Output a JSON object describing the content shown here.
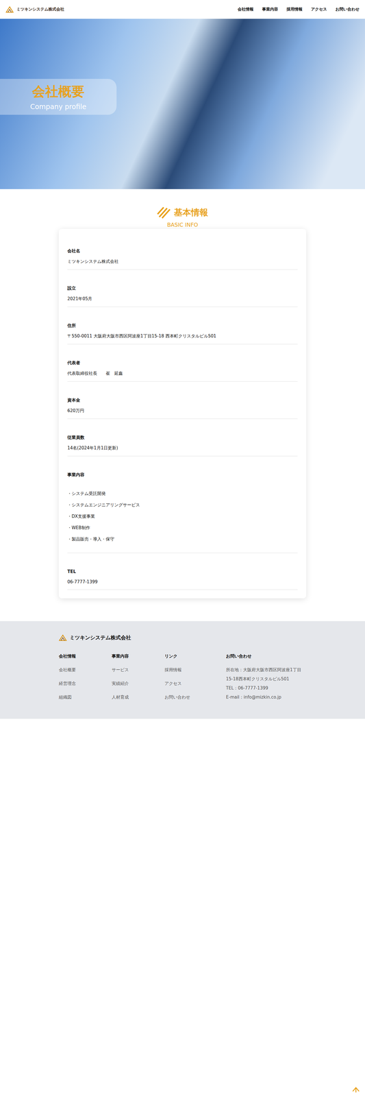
{
  "header": {
    "company": "ミツキンシステム株式会社",
    "nav": [
      "会社情報",
      "事業内容",
      "採用情報",
      "アクセス",
      "お問い合わせ"
    ]
  },
  "hero": {
    "title": "会社概要",
    "subtitle": "Company profile"
  },
  "section": {
    "title": "基本情報",
    "subtitle": "BASIC INFO"
  },
  "info": [
    {
      "kind": "text",
      "label": "会社名",
      "value": "ミツキンシステム株式会社"
    },
    {
      "kind": "text",
      "label": "設立",
      "value": "2021年05月"
    },
    {
      "kind": "text",
      "label": "住所",
      "value": "〒550-0011 大阪府大阪市西区阿波座1丁目15-18 西本町クリスタルビル501"
    },
    {
      "kind": "text",
      "label": "代表者",
      "value": "代表取締役社長　　崔　延鑫"
    },
    {
      "kind": "text",
      "label": "資本金",
      "value": "620万円"
    },
    {
      "kind": "text",
      "label": "従業員数",
      "value": "14名(2024年1月1日更新)"
    },
    {
      "kind": "list",
      "label": "事業内容",
      "items": [
        "・システム受託開発",
        "・システムエンジニアリングサービス",
        "・DX支援事業",
        "・WEB制作",
        "・製品販売・導入・保守"
      ]
    },
    {
      "kind": "text",
      "label": "TEL",
      "value": "06-7777-1399"
    }
  ],
  "footer": {
    "company": "ミツキンシステム株式会社",
    "columns": [
      {
        "title": "会社情報",
        "links": [
          "会社概要",
          "経営理念",
          "組織図"
        ]
      },
      {
        "title": "事業内容",
        "links": [
          "サービス",
          "実績紹介",
          "人材育成"
        ]
      },
      {
        "title": "リンク",
        "links": [
          "採用情報",
          "アクセス",
          "お問い合わせ"
        ]
      }
    ],
    "contact": {
      "title": "お問い合わせ",
      "lines": [
        "所在地：大阪府大阪市西区阿波座1丁目",
        "15-18西本町クリスタルビル501",
        "TEL：06-7777-1399",
        "E-mail：info@mizkin.co.jp"
      ]
    }
  }
}
